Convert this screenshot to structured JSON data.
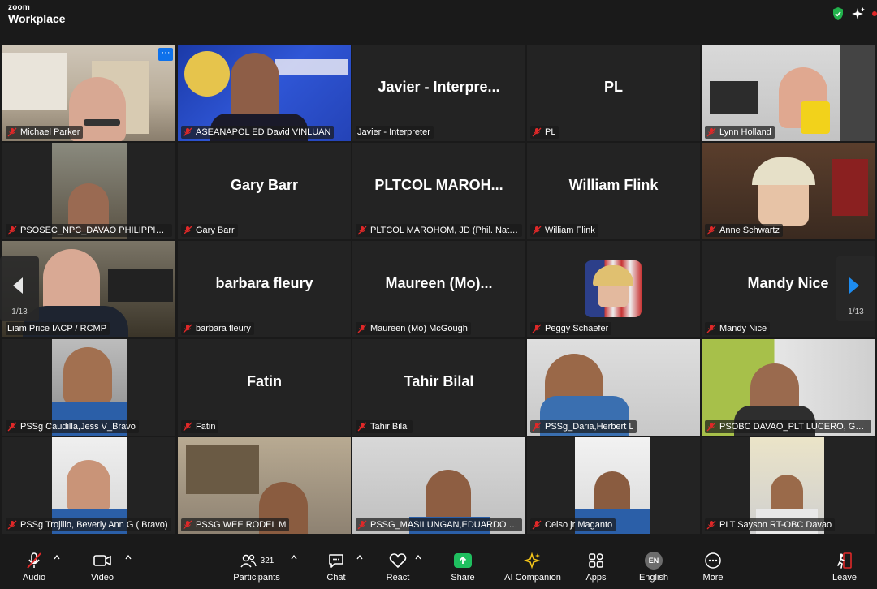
{
  "app": {
    "brand_top": "zoom",
    "brand_bottom": "Workplace"
  },
  "tiles": [
    {
      "name": "Michael Parker",
      "big": ""
    },
    {
      "name": "ASEANAPOL ED David VINLUAN",
      "big": ""
    },
    {
      "name": "Javier -  Interpreter",
      "big": "Javier -   Interpre..."
    },
    {
      "name": "PL",
      "big": "PL"
    },
    {
      "name": "Lynn Holland",
      "big": ""
    },
    {
      "name": "PSOSEC_NPC_DAVAO PHILIPPINES P...",
      "big": ""
    },
    {
      "name": "Gary Barr",
      "big": "Gary Barr"
    },
    {
      "name": "PLTCOL MAROHOM, JD (Phil. Natl Po...",
      "big": "PLTCOL  MAROH..."
    },
    {
      "name": "William Flink",
      "big": "William Flink"
    },
    {
      "name": "Anne Schwartz",
      "big": ""
    },
    {
      "name": "Liam Price IACP / RCMP",
      "big": ""
    },
    {
      "name": "barbara fleury",
      "big": "barbara fleury"
    },
    {
      "name": "Maureen (Mo) McGough",
      "big": "Maureen  (Mo)..."
    },
    {
      "name": "Peggy Schaefer",
      "big": ""
    },
    {
      "name": "Mandy Nice",
      "big": "Mandy Nice"
    },
    {
      "name": "PSSg Caudilla,Jess V_Bravo",
      "big": ""
    },
    {
      "name": "Fatin",
      "big": "Fatin"
    },
    {
      "name": "Tahir Bilal",
      "big": "Tahir Bilal"
    },
    {
      "name": "PSSg_Daria,Herbert L",
      "big": ""
    },
    {
      "name": "PSOBC DAVAO_PLT LUCERO, GEMM...",
      "big": ""
    },
    {
      "name": "PSSg Trojillo, Beverly Ann G ( Bravo)",
      "big": ""
    },
    {
      "name": "PSSG WEE RODEL M",
      "big": ""
    },
    {
      "name": "PSSG_MASILUNGAN,EDUARDO C_B...",
      "big": ""
    },
    {
      "name": "Celso jr Maganto",
      "big": ""
    },
    {
      "name": "PLT Sayson RT-OBC Davao",
      "big": ""
    }
  ],
  "pager": {
    "left_count": "1/13",
    "right_count": "1/13"
  },
  "toolbar": {
    "audio": "Audio",
    "video": "Video",
    "participants": "Participants",
    "participants_count": "321",
    "chat": "Chat",
    "react": "React",
    "share": "Share",
    "ai_companion": "AI Companion",
    "apps": "Apps",
    "language_badge": "EN",
    "language": "English",
    "more": "More",
    "leave": "Leave"
  },
  "colors": {
    "active_speaker": "#33c46a",
    "share": "#1fbf5f",
    "accent_blue": "#0e71eb",
    "muted_red": "#e02828"
  },
  "icons": [
    "shield-check-icon",
    "sparkle-icon",
    "muted-mic-icon",
    "video-camera-icon",
    "participants-icon",
    "chat-icon",
    "heart-icon",
    "share-arrow-icon",
    "ai-sparkle-icon",
    "apps-icon",
    "more-dots-icon",
    "leave-icon",
    "chevron-left-icon",
    "chevron-right-icon"
  ]
}
